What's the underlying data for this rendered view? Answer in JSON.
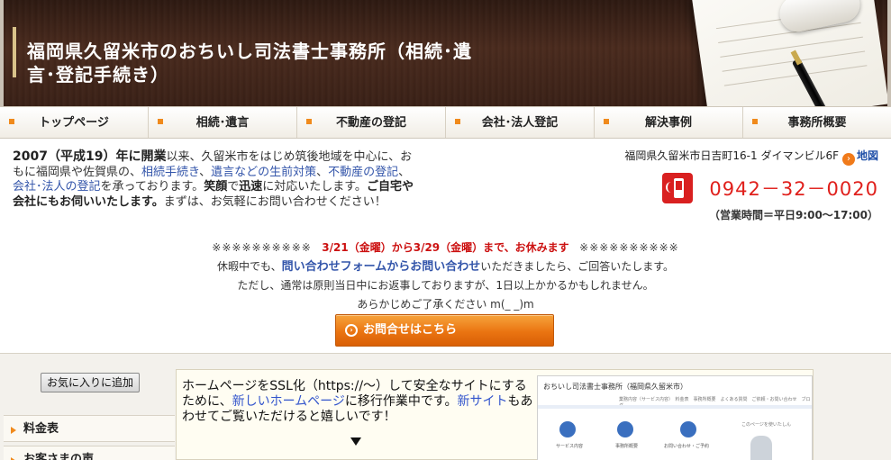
{
  "header": {
    "title": "福岡県久留米市のおちいし司法書士事務所（相続･遺言･登記手続き）"
  },
  "nav": {
    "items": [
      {
        "label": "トップページ"
      },
      {
        "label": "相続･遺言"
      },
      {
        "label": "不動産の登記"
      },
      {
        "label": "会社･法人登記"
      },
      {
        "label": "解決事例"
      },
      {
        "label": "事務所概要"
      }
    ]
  },
  "intro": {
    "year": "2007（平成19）年に開業",
    "t1": "以来、久留米市をはじめ筑後地域を中心に、おもに福岡県や佐賀県の、",
    "link1": "相続手続き",
    "t2": "、",
    "link2": "遺言などの生前対策",
    "t3": "、",
    "link3": "不動産の登記",
    "t4": "、",
    "link4": "会社･法人の登記",
    "t5": "を承っております。",
    "b1": "笑顔",
    "t6": "で",
    "b2": "迅速",
    "t7": "に対応いたします。",
    "b3": "ご自宅や会社にもお伺いいたします。",
    "t8": "まずは、お気軽にお問い合わせください！"
  },
  "contact": {
    "address": "福岡県久留米市日吉町16-1 ダイマンビル6F",
    "map_label": "地図",
    "phone": "0942－32－0020",
    "hours": "（営業時間＝平日9:00～17:00）"
  },
  "notice": {
    "stars_left": "※※※※※※※※※※",
    "holiday": "3/21（金曜）から3/29（金曜）まで、お休みます",
    "stars_right": "※※※※※※※※※※",
    "line2_pre": "休暇中でも、",
    "line2_link": "問い合わせフォームからお問い合わせ",
    "line2_post": "いただきましたら、ご回答いたします。",
    "line3": "ただし、通常は原則当日中にお返事しておりますが、1日以上かかるかもしれません。",
    "line4": "あらかじめご了承ください m(_ _)m",
    "button": "お問合せはこちら"
  },
  "sidebar": {
    "bookmark": "お気に入りに追加",
    "items": [
      {
        "label": "料金表"
      },
      {
        "label": "お客さまの声"
      }
    ]
  },
  "announce": {
    "t1": "ホームページをSSL化（https://～）して安全なサイトにするために、",
    "link1": "新しいホームページ",
    "t2": "に移行作業中です。",
    "link2": "新サイト",
    "t3": "もあわせてご覧いただけると嬉しいです！",
    "preview": {
      "title": "おちいし司法書士事務所（福岡県久留米市）",
      "nav": "業務内容（サービス内容）　料金表　事務所概要　よくある質問　ご依頼・お問い合わせ　ブログ",
      "labels": [
        "サービス内容",
        "事務所概要",
        "お問い合わせ・ご予約"
      ],
      "side": "このページを使いたしん"
    }
  },
  "colors": {
    "accent": "#f08a1c",
    "phone": "#e0201c",
    "link": "#3355aa",
    "header_bg": "#3a2117"
  }
}
